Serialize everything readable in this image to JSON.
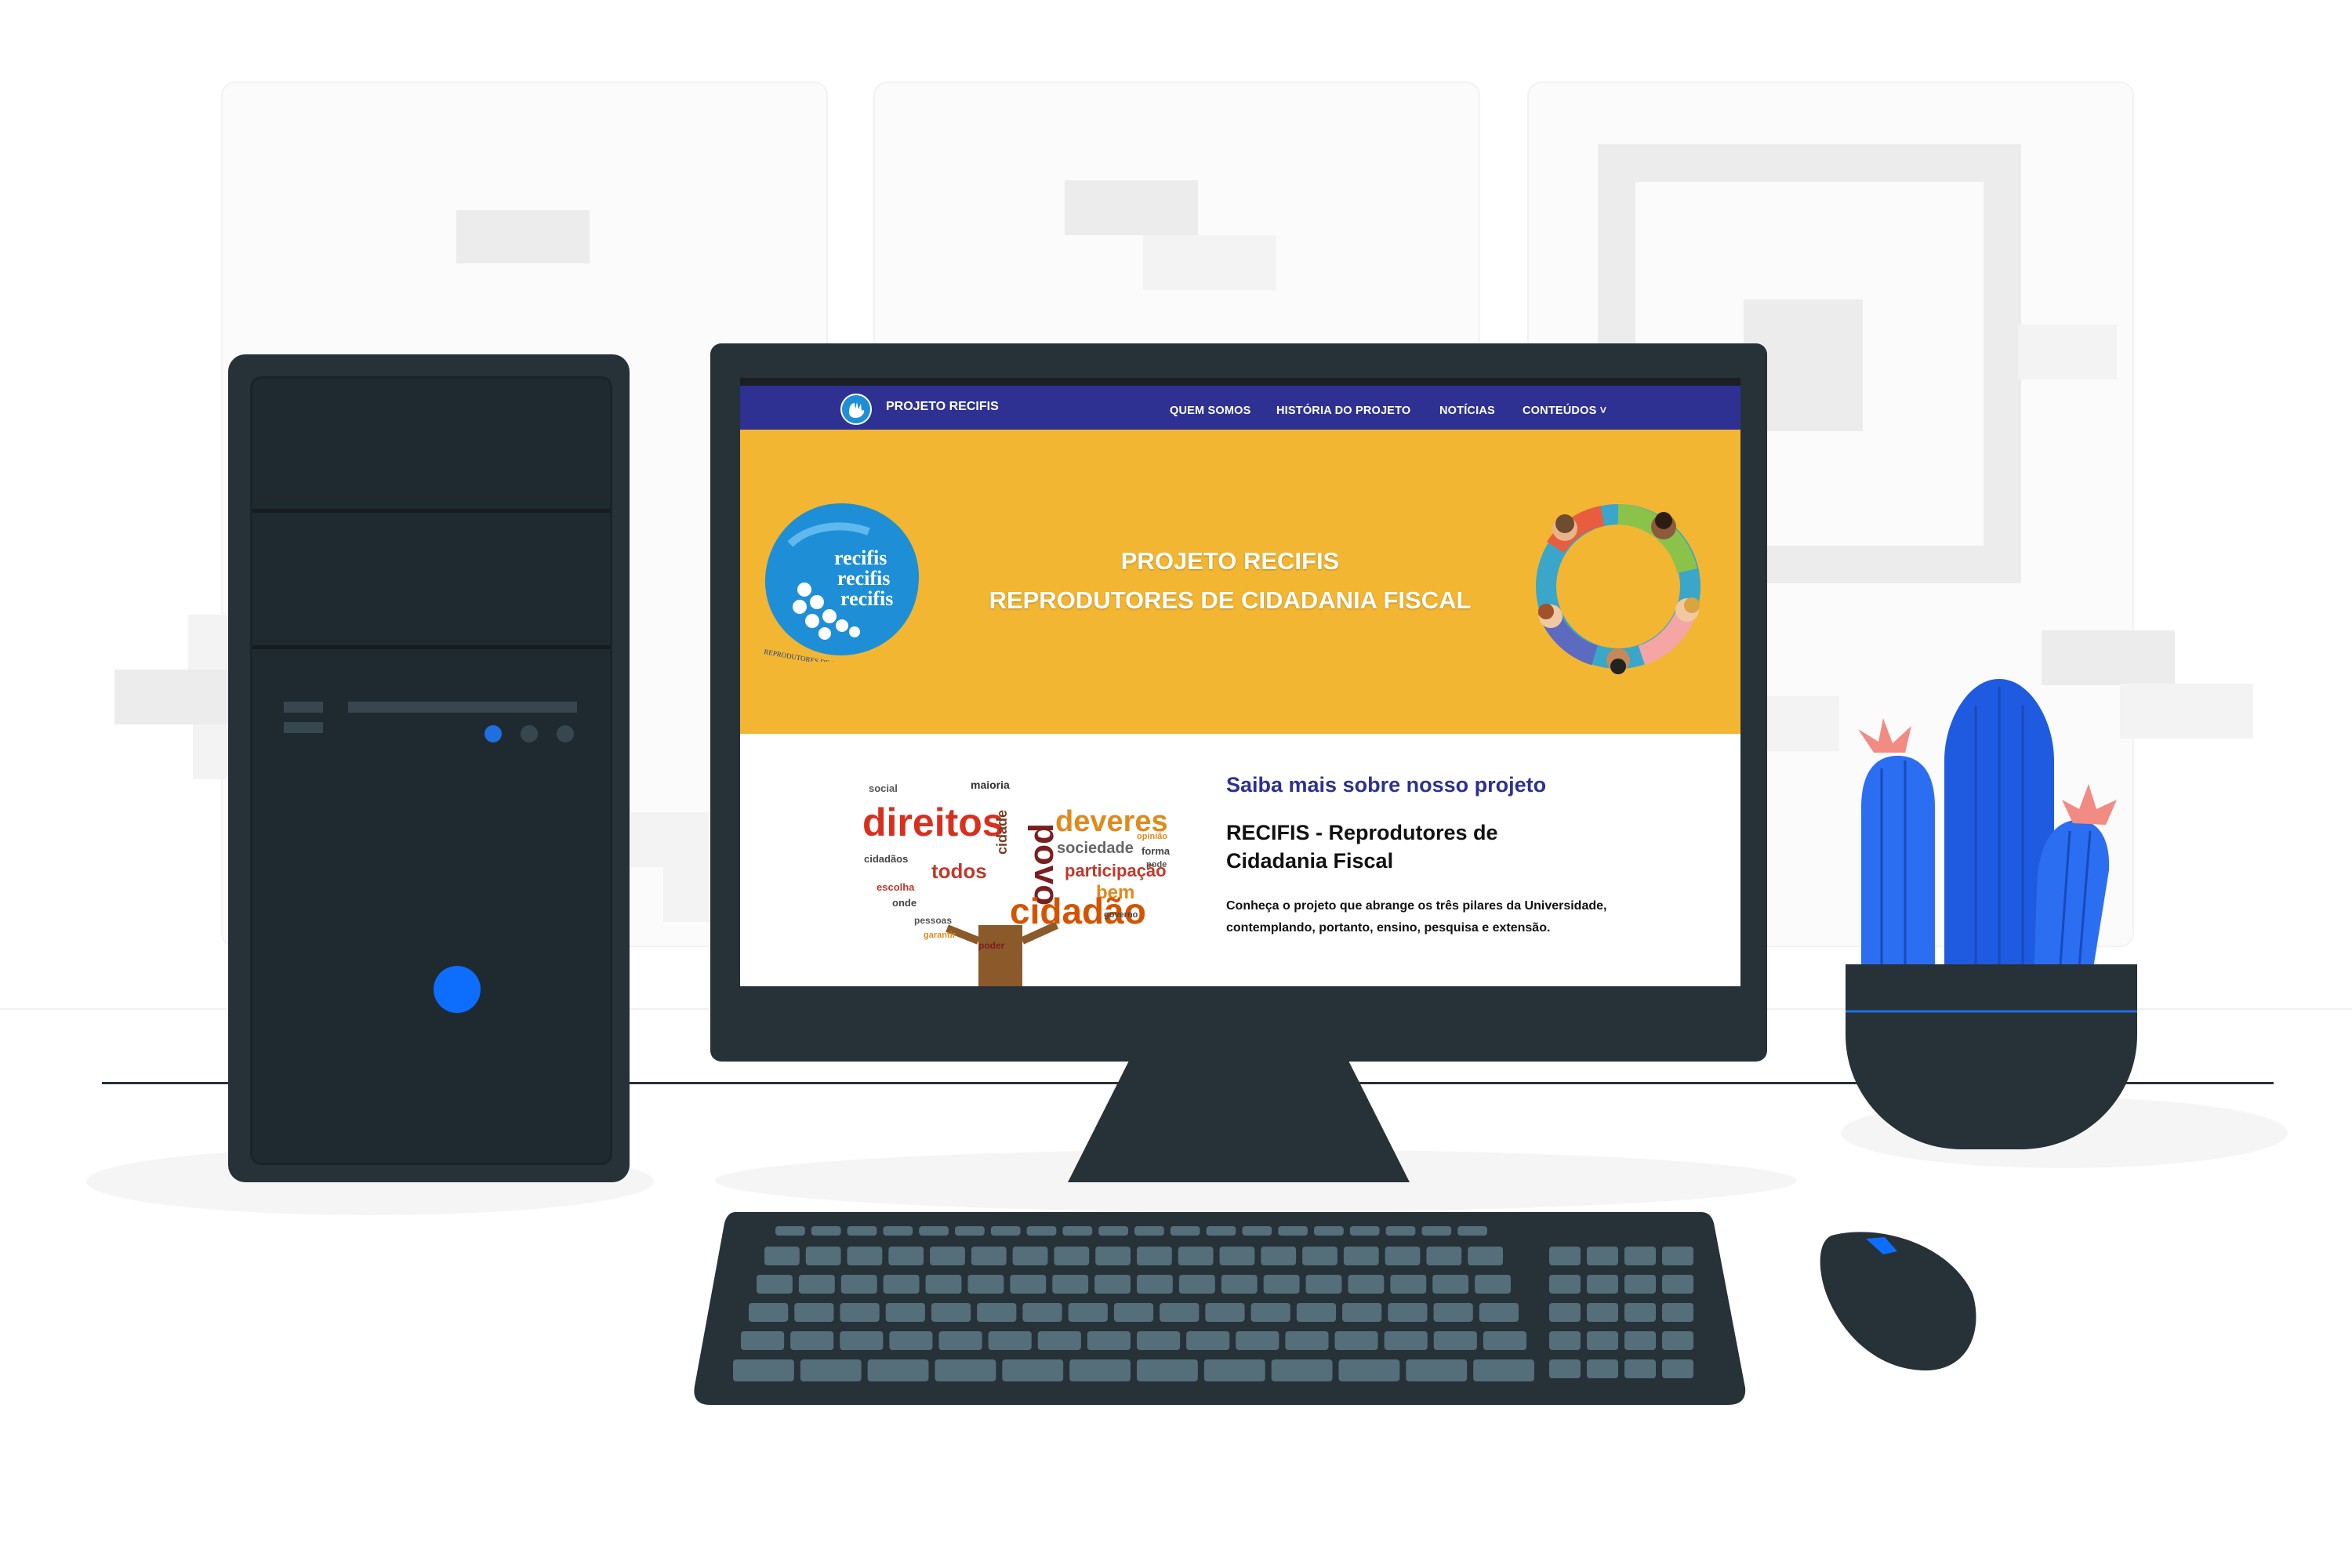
{
  "site": {
    "brand": "PROJETO RECIFIS",
    "nav": [
      {
        "label": "QUEM SOMOS"
      },
      {
        "label": "HISTÓRIA DO PROJETO"
      },
      {
        "label": "NOTÍCIAS"
      },
      {
        "label": "CONTEÚDOS ˅"
      }
    ],
    "hero": {
      "line1": "PROJETO RECIFIS",
      "line2": "REPRODUTORES DE CIDADANIA FISCAL",
      "logo_text": [
        "recifis",
        "recifis",
        "recifis"
      ],
      "logo_caption": "REPRODUTORES DE CIDADANIA FISCAL"
    },
    "content": {
      "heading": "Saiba mais sobre nosso projeto",
      "subheading": "RECIFIS - Reprodutores de Cidadania Fiscal",
      "body": "Conheça o projeto que abrange os três pilares da Universidade, contemplando, portanto, ensino, pesquisa e extensão."
    },
    "word_cloud": {
      "big": [
        "direitos",
        "povo",
        "deveres",
        "cidadão"
      ],
      "medium": [
        "sociedade",
        "participação",
        "todos",
        "bem",
        "cidade"
      ],
      "small": [
        "social",
        "maioria",
        "cidadãos",
        "escolha",
        "onde",
        "pessoas",
        "poder",
        "forma",
        "opinião",
        "pode",
        "governo",
        "garantir"
      ]
    }
  },
  "colors": {
    "navbar": "#2e3192",
    "hero": "#f2b632",
    "device": "#263238",
    "accent_blue": "#0d6efd",
    "cactus_blue": "#1e5be0",
    "cactus_flower": "#f28b82"
  }
}
